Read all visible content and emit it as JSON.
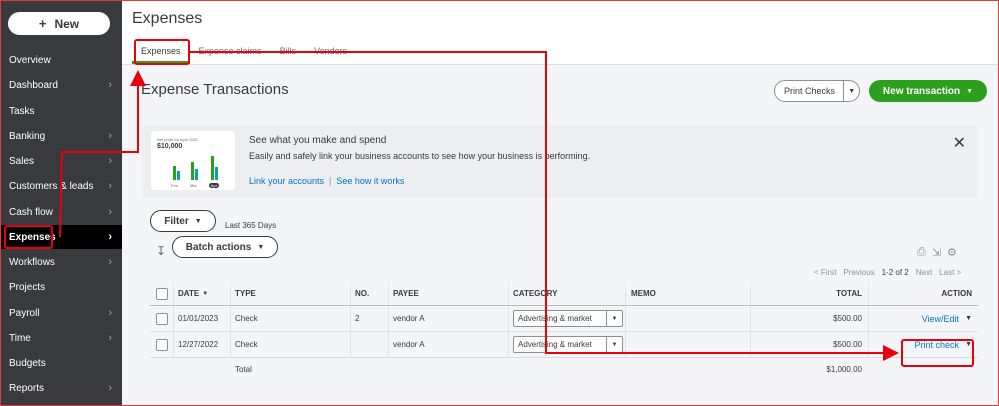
{
  "sidebar": {
    "new_label": "New",
    "items": [
      {
        "label": "Overview",
        "chevron": false
      },
      {
        "label": "Dashboard",
        "chevron": true
      },
      {
        "label": "Tasks",
        "chevron": false
      },
      {
        "label": "Banking",
        "chevron": true
      },
      {
        "label": "Sales",
        "chevron": true
      },
      {
        "label": "Customers & leads",
        "chevron": true
      },
      {
        "label": "Cash flow",
        "chevron": true
      },
      {
        "label": "Expenses",
        "chevron": true,
        "active": true
      },
      {
        "label": "Workflows",
        "chevron": true
      },
      {
        "label": "Projects",
        "chevron": false
      },
      {
        "label": "Payroll",
        "chevron": true
      },
      {
        "label": "Time",
        "chevron": true
      },
      {
        "label": "Budgets",
        "chevron": false
      },
      {
        "label": "Reports",
        "chevron": true
      }
    ]
  },
  "header": {
    "title": "Expenses",
    "tabs": [
      "Expenses",
      "Expense claims",
      "Bills",
      "Vendors"
    ]
  },
  "main": {
    "title": "Expense Transactions",
    "print_checks": "Print Checks",
    "new_transaction": "New transaction"
  },
  "promo": {
    "card_small": "Net profit for April 2021",
    "card_amount": "$10,000",
    "card_months": [
      "Feb",
      "Mar",
      "Apr"
    ],
    "heading": "See what you make and spend",
    "text": "Easily and safely link your business accounts to see how your business is performing.",
    "link_accounts": "Link your accounts",
    "link_how": "See how it works"
  },
  "toolbar": {
    "filter": "Filter",
    "range": "Last 365 Days",
    "batch": "Batch actions"
  },
  "pager": {
    "first": "< First",
    "previous": "Previous",
    "count": "1-2 of 2",
    "next": "Next",
    "last": "Last >"
  },
  "table": {
    "headers": {
      "date": "DATE",
      "type": "TYPE",
      "no": "NO.",
      "payee": "PAYEE",
      "category": "CATEGORY",
      "memo": "MEMO",
      "total": "TOTAL",
      "action": "ACTION"
    },
    "rows": [
      {
        "date": "01/01/2023",
        "type": "Check",
        "no": "2",
        "payee": "vendor A",
        "category": "Advertising & market",
        "total": "$500.00",
        "action": "View/Edit"
      },
      {
        "date": "12/27/2022",
        "type": "Check",
        "no": "",
        "payee": "vendor A",
        "category": "Advertising & market",
        "total": "$500.00",
        "action": "Print check"
      }
    ],
    "total_label": "Total",
    "total_value": "$1,000.00"
  },
  "colors": {
    "accent": "#2ca01c",
    "link": "#0077c5",
    "annotation": "#e8000b",
    "sidebar": "#393a3d"
  }
}
